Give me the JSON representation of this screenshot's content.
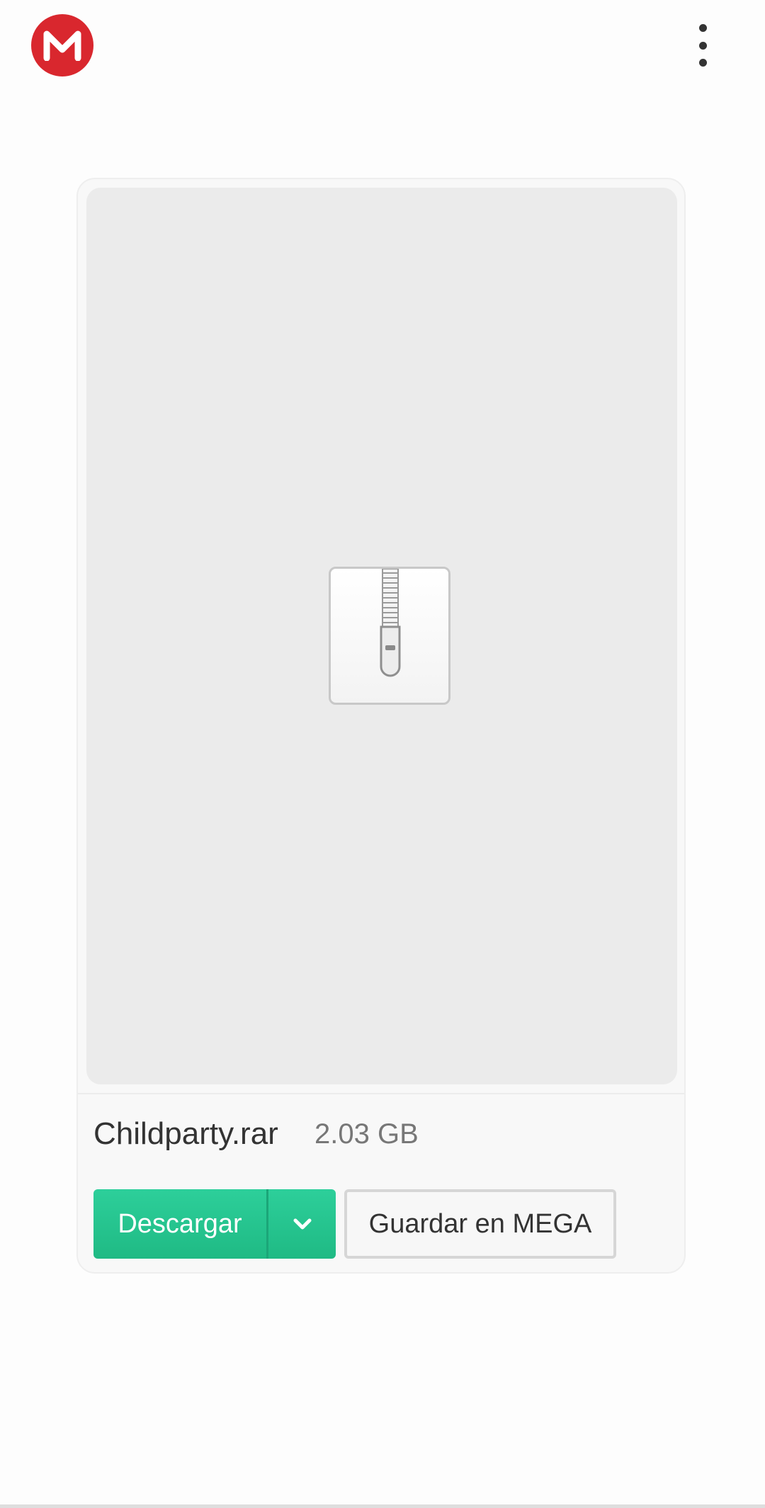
{
  "header": {
    "logo_icon": "mega-logo-icon",
    "logo_color": "#d9272e",
    "menu_icon": "more-vert-icon"
  },
  "file": {
    "preview_icon": "archive-zip-icon",
    "name": "Childparty.rar",
    "size": "2.03 GB"
  },
  "actions": {
    "download_label": "Descargar",
    "download_options_icon": "chevron-down-icon",
    "download_color": "#26c48f",
    "save_label": "Guardar en MEGA"
  }
}
